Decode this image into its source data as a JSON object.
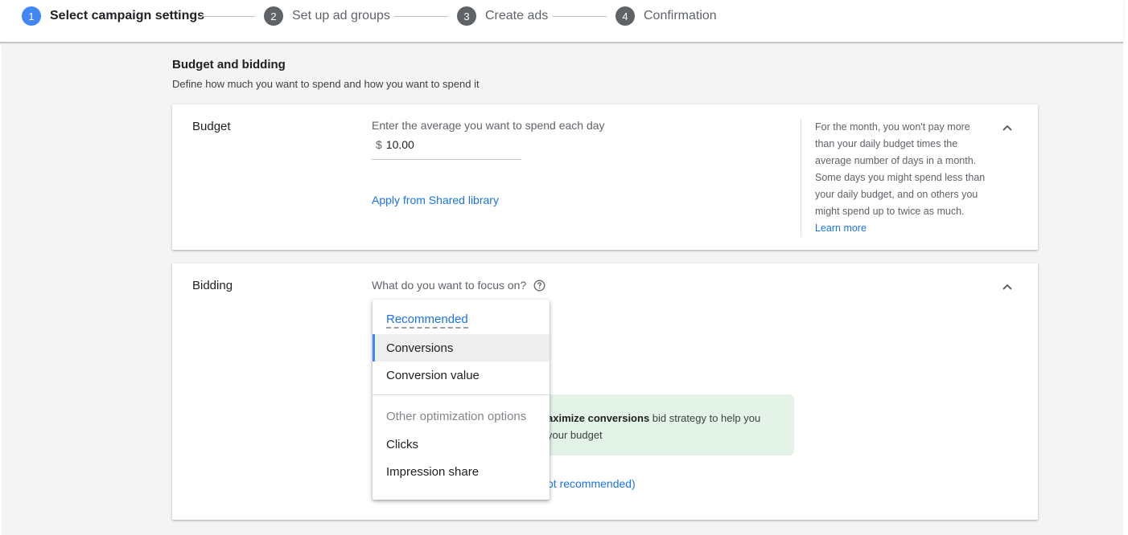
{
  "stepper": {
    "steps": [
      {
        "number": "1",
        "label": "Select campaign settings",
        "active": true
      },
      {
        "number": "2",
        "label": "Set up ad groups",
        "active": false
      },
      {
        "number": "3",
        "label": "Create ads",
        "active": false
      },
      {
        "number": "4",
        "label": "Confirmation",
        "active": false
      }
    ]
  },
  "section": {
    "title": "Budget and bidding",
    "subtitle": "Define how much you want to spend and how you want to spend it"
  },
  "budget": {
    "heading": "Budget",
    "prompt": "Enter the average you want to spend each day",
    "currency": "$",
    "value": "10.00",
    "shared_link": "Apply from Shared library",
    "help_text": "For the month, you won't pay more than your daily budget times the average number of days in a month. Some days you might spend less than your daily budget, and on others you might spend up to twice as much.",
    "help_link": "Learn more"
  },
  "bidding": {
    "heading": "Bidding",
    "question": "What do you want to focus on?",
    "info_bold": "aximize conversions",
    "info_rest_line1": " bid strategy to help you",
    "info_line2": "your budget",
    "manual_link": "ot recommended)"
  },
  "menu": {
    "recommended_header": "Recommended",
    "items_recommended": [
      "Conversions",
      "Conversion value"
    ],
    "selected": "Conversions",
    "other_header": "Other optimization options",
    "items_other": [
      "Clicks",
      "Impression share"
    ]
  },
  "colors": {
    "accent": "#4285f4",
    "link": "#1a73e8",
    "info_bg": "#e4f3e8"
  }
}
